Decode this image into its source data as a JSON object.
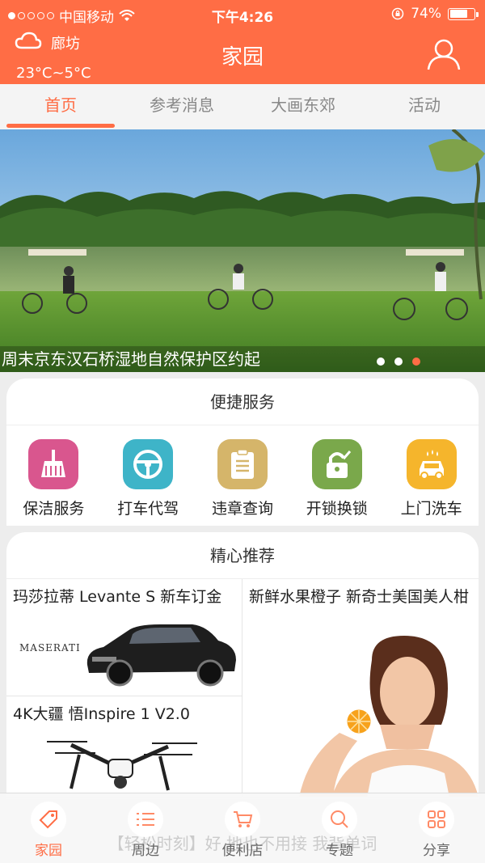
{
  "status_bar": {
    "carrier": "中国移动",
    "time": "下午4:26",
    "battery": "74%",
    "battery_level": 0.74
  },
  "header": {
    "city": "廊坊",
    "temperature": "23°C~5°C",
    "title": "家园"
  },
  "tabs": [
    {
      "label": "首页",
      "active": true
    },
    {
      "label": "参考消息",
      "active": false
    },
    {
      "label": "大画东郊",
      "active": false
    },
    {
      "label": "活动",
      "active": false
    }
  ],
  "banner": {
    "caption": "周末京东汉石桥湿地自然保护区约起",
    "pages": 3,
    "current_page": 3
  },
  "services": {
    "title": "便捷服务",
    "items": [
      {
        "label": "保洁服务",
        "icon": "broom-icon",
        "color": "#d9568e"
      },
      {
        "label": "打车代驾",
        "icon": "steering-wheel-icon",
        "color": "#3eb4c8"
      },
      {
        "label": "违章查询",
        "icon": "clipboard-icon",
        "color": "#d5b56a"
      },
      {
        "label": "开锁换锁",
        "icon": "lock-icon",
        "color": "#7aa84b"
      },
      {
        "label": "上门洗车",
        "icon": "car-wash-icon",
        "color": "#f5b52c"
      }
    ]
  },
  "recommend": {
    "title": "精心推荐",
    "items": [
      {
        "title": "玛莎拉蒂 Levante S 新车订金",
        "brand": "MASERATI"
      },
      {
        "title": "新鲜水果橙子 新奇士美国美人柑"
      },
      {
        "title": "4K大疆 悟Inspire 1 V2.0"
      }
    ]
  },
  "bottom_nav": {
    "ghost_text": "【轻松时刻】好 地也不用接 我背单词",
    "items": [
      {
        "label": "家园",
        "icon": "home-tag-icon",
        "active": true
      },
      {
        "label": "周边",
        "icon": "list-icon",
        "active": false
      },
      {
        "label": "便利店",
        "icon": "cart-icon",
        "active": false
      },
      {
        "label": "专题",
        "icon": "search-icon",
        "active": false
      },
      {
        "label": "分享",
        "icon": "grid-icon",
        "active": false
      }
    ]
  },
  "colors": {
    "brand": "#ff6d45"
  }
}
